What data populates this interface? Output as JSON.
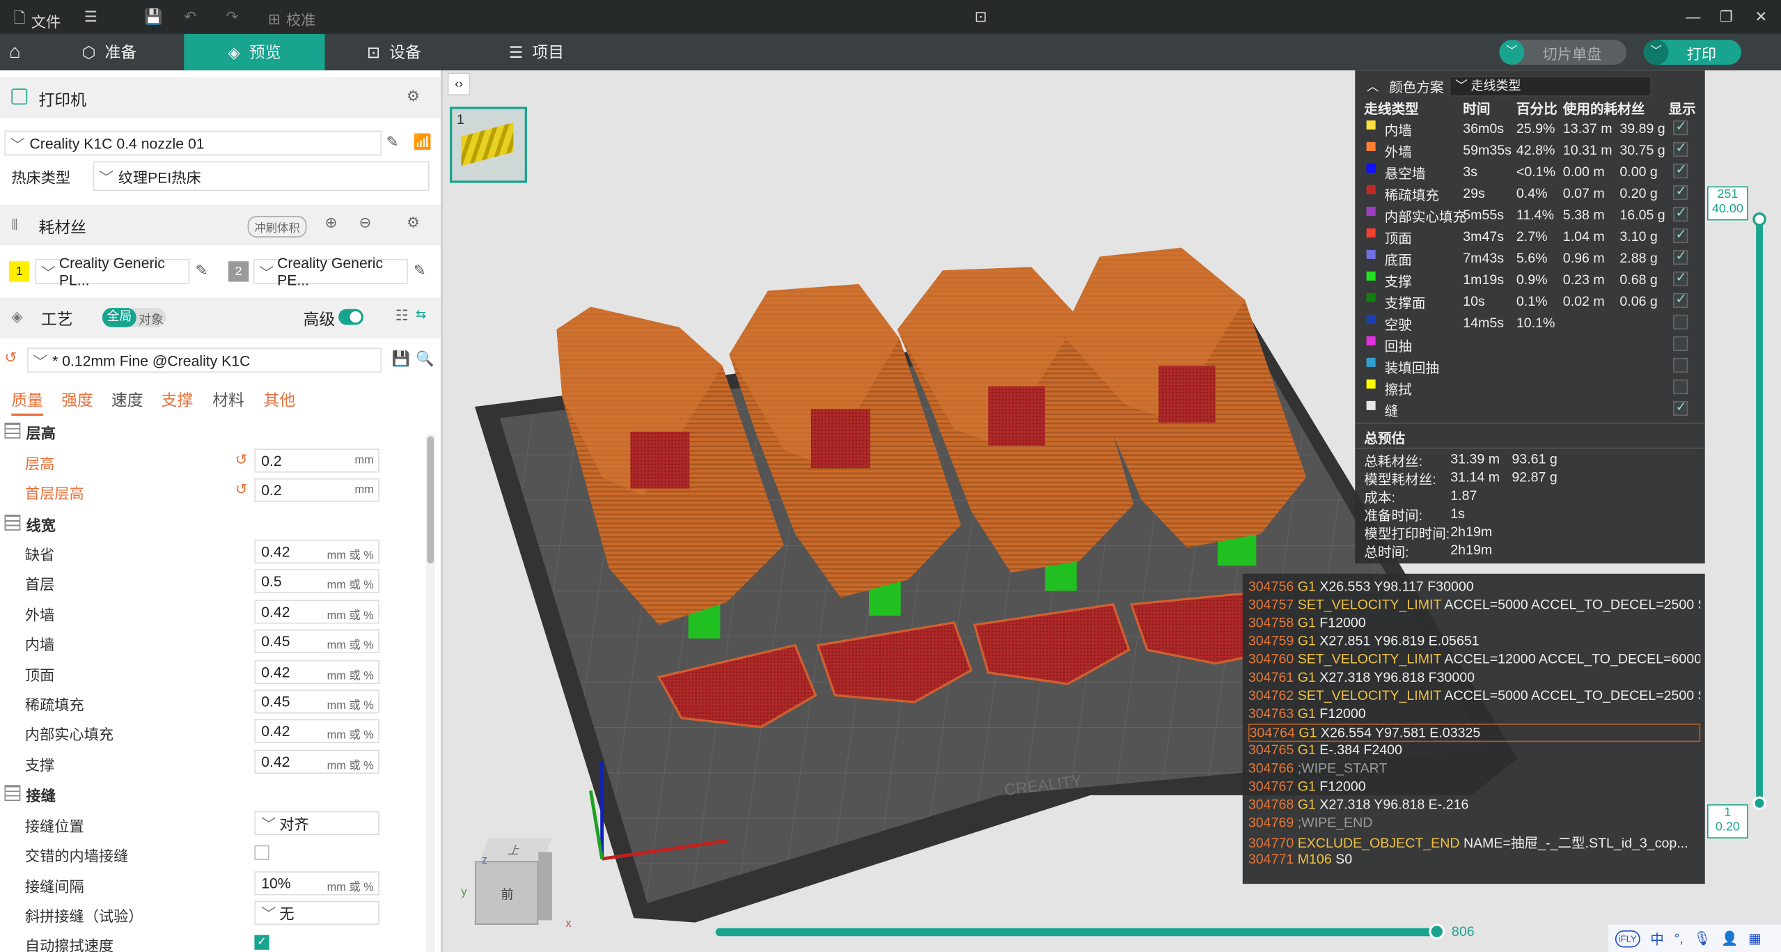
{
  "titlebar": {
    "file": "文件",
    "calibrate": "校准"
  },
  "nav": {
    "prepare": "准备",
    "preview": "预览",
    "device": "设备",
    "project": "项目",
    "slice_single": "切片单盘",
    "print": "打印"
  },
  "printer": {
    "section": "打印机",
    "name": "Creality K1C 0.4 nozzle 01",
    "bed_label": "热床类型",
    "bed_value": "纹理PEI热床"
  },
  "filament": {
    "section": "耗材丝",
    "flush_button": "冲刷体积",
    "slot1_num": "1",
    "slot1_name": "Creality Generic PL...",
    "slot1_color": "#ffee00",
    "slot2_num": "2",
    "slot2_name": "Creality Generic PE...",
    "slot2_color": "#9a9a9a"
  },
  "process": {
    "section": "工艺",
    "toggle_global": "全局",
    "toggle_object": "对象",
    "advanced": "高级",
    "preset": "* 0.12mm Fine @Creality K1C"
  },
  "tabs": [
    "质量",
    "强度",
    "速度",
    "支撑",
    "材料",
    "其他"
  ],
  "settings": {
    "layer_group": "层高",
    "layer_height": {
      "label": "层高",
      "value": "0.2",
      "unit": "mm"
    },
    "first_layer_height": {
      "label": "首层层高",
      "value": "0.2",
      "unit": "mm"
    },
    "width_group": "线宽",
    "widths": [
      {
        "label": "缺省",
        "value": "0.42",
        "unit": "mm 或 %"
      },
      {
        "label": "首层",
        "value": "0.5",
        "unit": "mm 或 %"
      },
      {
        "label": "外墙",
        "value": "0.42",
        "unit": "mm 或 %"
      },
      {
        "label": "内墙",
        "value": "0.45",
        "unit": "mm 或 %"
      },
      {
        "label": "顶面",
        "value": "0.42",
        "unit": "mm 或 %"
      },
      {
        "label": "稀疏填充",
        "value": "0.45",
        "unit": "mm 或 %"
      },
      {
        "label": "内部实心填充",
        "value": "0.42",
        "unit": "mm 或 %"
      },
      {
        "label": "支撑",
        "value": "0.42",
        "unit": "mm 或 %"
      }
    ],
    "seam_group": "接缝",
    "seam_position": {
      "label": "接缝位置",
      "value": "对齐"
    },
    "staggered_seam": {
      "label": "交错的内墙接缝"
    },
    "seam_gap": {
      "label": "接缝间隔",
      "value": "10%",
      "unit": "mm 或 %"
    },
    "scarf_seam": {
      "label": "斜拼接缝（试验）",
      "value": "无"
    },
    "auto_wipe": {
      "label": "自动擦拭速度"
    }
  },
  "plate": {
    "number": "1"
  },
  "legend": {
    "title": "颜色方案",
    "scheme": "走线类型",
    "headers": [
      "走线类型",
      "时间",
      "百分比",
      "使用的耗材丝",
      "显示"
    ],
    "rows": [
      {
        "name": "内墙",
        "color": "#ffe040",
        "time": "36m0s",
        "pct": "25.9%",
        "len": "13.37 m",
        "wt": "39.89 g",
        "on": true
      },
      {
        "name": "外墙",
        "color": "#ff8030",
        "time": "59m35s",
        "pct": "42.8%",
        "len": "10.31 m",
        "wt": "30.75 g",
        "on": true
      },
      {
        "name": "悬空墙",
        "color": "#1010ff",
        "time": "3s",
        "pct": "<0.1%",
        "len": "0.00 m",
        "wt": "0.00 g",
        "on": true
      },
      {
        "name": "稀疏填充",
        "color": "#c02828",
        "time": "29s",
        "pct": "0.4%",
        "len": "0.07 m",
        "wt": "0.20 g",
        "on": true
      },
      {
        "name": "内部实心填充",
        "color": "#a040c0",
        "time": "5m55s",
        "pct": "11.4%",
        "len": "5.38 m",
        "wt": "16.05 g",
        "on": true
      },
      {
        "name": "顶面",
        "color": "#f04030",
        "time": "3m47s",
        "pct": "2.7%",
        "len": "1.04 m",
        "wt": "3.10 g",
        "on": true
      },
      {
        "name": "底面",
        "color": "#7070e0",
        "time": "7m43s",
        "pct": "5.6%",
        "len": "0.96 m",
        "wt": "2.88 g",
        "on": true
      },
      {
        "name": "支撑",
        "color": "#20e020",
        "time": "1m19s",
        "pct": "0.9%",
        "len": "0.23 m",
        "wt": "0.68 g",
        "on": true
      },
      {
        "name": "支撑面",
        "color": "#108010",
        "time": "10s",
        "pct": "0.1%",
        "len": "0.02 m",
        "wt": "0.06 g",
        "on": true
      },
      {
        "name": "空驶",
        "color": "#1a40b0",
        "time": "14m5s",
        "pct": "10.1%",
        "len": "",
        "wt": "",
        "on": false
      },
      {
        "name": "回抽",
        "color": "#e030e0",
        "time": "",
        "pct": "",
        "len": "",
        "wt": "",
        "on": false
      },
      {
        "name": "装填回抽",
        "color": "#30a0d0",
        "time": "",
        "pct": "",
        "len": "",
        "wt": "",
        "on": false
      },
      {
        "name": "擦拭",
        "color": "#ffff00",
        "time": "",
        "pct": "",
        "len": "",
        "wt": "",
        "on": false
      },
      {
        "name": "缝",
        "color": "#e8e8e8",
        "time": "",
        "pct": "",
        "len": "",
        "wt": "",
        "on": true
      }
    ],
    "summary_title": "总预估",
    "summary": [
      {
        "label": "总耗材丝:",
        "v1": "31.39 m",
        "v2": "93.61 g"
      },
      {
        "label": "模型耗材丝:",
        "v1": "31.14 m",
        "v2": "92.87 g"
      },
      {
        "label": "成本:",
        "v1": "1.87",
        "v2": ""
      },
      {
        "label": "准备时间:",
        "v1": "1s",
        "v2": ""
      },
      {
        "label": "模型打印时间:",
        "v1": "2h19m",
        "v2": ""
      },
      {
        "label": "总时间:",
        "v1": "2h19m",
        "v2": ""
      }
    ]
  },
  "gcode": [
    {
      "n": "304756",
      "c": "G1",
      "a": "X26.553 Y98.117 F30000"
    },
    {
      "n": "304757",
      "c": "SET_VELOCITY_LIMIT",
      "a": "ACCEL=5000 ACCEL_TO_DECEL=2500 SQ..."
    },
    {
      "n": "304758",
      "c": "G1",
      "a": "F12000"
    },
    {
      "n": "304759",
      "c": "G1",
      "a": "X27.851 Y96.819 E.05651"
    },
    {
      "n": "304760",
      "c": "SET_VELOCITY_LIMIT",
      "a": "ACCEL=12000 ACCEL_TO_DECEL=6000 S..."
    },
    {
      "n": "304761",
      "c": "G1",
      "a": "X27.318 Y96.818 F30000"
    },
    {
      "n": "304762",
      "c": "SET_VELOCITY_LIMIT",
      "a": "ACCEL=5000 ACCEL_TO_DECEL=2500 SQ..."
    },
    {
      "n": "304763",
      "c": "G1",
      "a": "F12000"
    },
    {
      "n": "304764",
      "c": "G1",
      "a": "X26.554 Y97.581 E.03325"
    },
    {
      "n": "304765",
      "c": "G1",
      "a": "E-.384 F2400"
    },
    {
      "n": "304766",
      "c": "",
      "a": ";WIPE_START"
    },
    {
      "n": "304767",
      "c": "G1",
      "a": "F12000"
    },
    {
      "n": "304768",
      "c": "G1",
      "a": "X27.318 Y96.818 E-.216"
    },
    {
      "n": "304769",
      "c": "",
      "a": ";WIPE_END"
    },
    {
      "n": "304770",
      "c": "EXCLUDE_OBJECT_END",
      "a": "NAME=抽屉_-_二型.STL_id_3_cop..."
    },
    {
      "n": "304771",
      "c": "M106",
      "a": "S0"
    }
  ],
  "layer_slider": {
    "top_layer": "251",
    "top_z": "40.00",
    "bottom_layer": "1",
    "bottom_z": "0.20"
  },
  "move_slider": {
    "value": "806"
  },
  "view_cube": {
    "top": "上",
    "front": "前"
  },
  "axes": {
    "x": "x",
    "y": "y",
    "z": "z"
  },
  "bed_brand": "CREALITY",
  "ime": {
    "brand": "iFLY",
    "lang": "中"
  }
}
